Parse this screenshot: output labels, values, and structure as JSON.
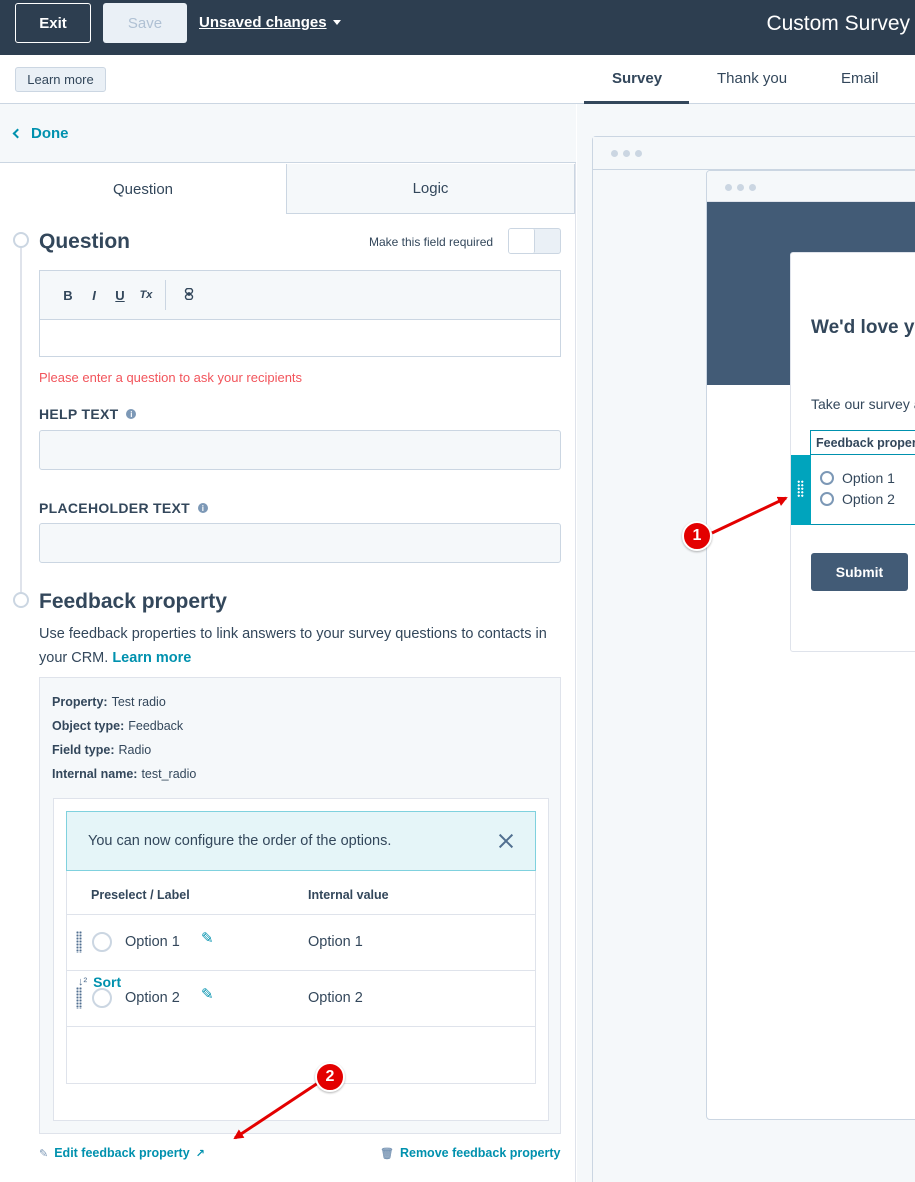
{
  "topbar": {
    "exit_label": "Exit",
    "save_label": "Save",
    "unsaved_label": "Unsaved changes",
    "title": "Custom Survey"
  },
  "subbar": {
    "learn_more_label": "Learn more",
    "tabs": [
      {
        "label": "Survey",
        "active": true
      },
      {
        "label": "Thank you",
        "active": false
      },
      {
        "label": "Email",
        "active": false
      }
    ]
  },
  "left_panel": {
    "done_label": "Done",
    "editor_tabs": [
      {
        "label": "Question",
        "active": true
      },
      {
        "label": "Logic",
        "active": false
      }
    ],
    "question": {
      "title": "Question",
      "required_label": "Make this field required",
      "required_on": false,
      "toolbar": [
        "B",
        "I",
        "U",
        "Tx",
        "link-icon"
      ],
      "value": "",
      "error": "Please enter a question to ask your recipients"
    },
    "help_text": {
      "label": "HELP TEXT",
      "value": ""
    },
    "placeholder_text": {
      "label": "PLACEHOLDER TEXT",
      "value": ""
    },
    "feedback_property": {
      "title": "Feedback property",
      "description": "Use feedback properties to link answers to your survey questions to contacts in your CRM.",
      "learn_more": "Learn more",
      "details": [
        {
          "key": "Property:",
          "value": "Test radio"
        },
        {
          "key": "Object type:",
          "value": "Feedback"
        },
        {
          "key": "Field type:",
          "value": "Radio"
        },
        {
          "key": "Internal name:",
          "value": "test_radio"
        }
      ],
      "notice": "You can now configure the order of the options.",
      "table": {
        "headers": [
          "Preselect / Label",
          "Internal value"
        ],
        "rows": [
          {
            "label": "Option 1",
            "value": "Option 1"
          },
          {
            "label": "Option 2",
            "value": "Option 2"
          }
        ]
      },
      "sort_label": "Sort",
      "edit_label": "Edit feedback property",
      "remove_label": "Remove feedback property"
    }
  },
  "preview": {
    "title": "We'd love y",
    "subtitle": "Take our survey a",
    "field_label": "Feedback proper",
    "options": [
      "Option 1",
      "Option 2"
    ],
    "submit_label": "Submit"
  },
  "annotations": [
    {
      "number": "1"
    },
    {
      "number": "2"
    }
  ],
  "colors": {
    "accent": "#0091ae",
    "header": "#2d3e50",
    "hero": "#425b76",
    "annotation": "#e30000",
    "error": "#f2545b"
  }
}
